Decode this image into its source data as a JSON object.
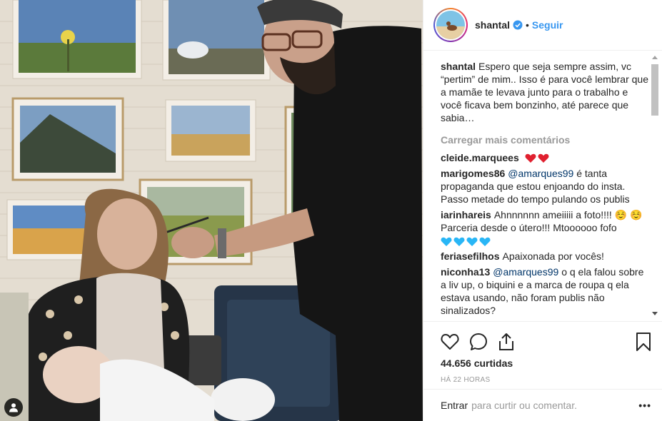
{
  "post": {
    "username": "shantal",
    "follow_label": "Seguir",
    "separator": "•"
  },
  "caption": {
    "username": "shantal",
    "text": "Espero que seja sempre assim, vc “pertim” de mim.. Isso é para você lembrar que a mamãe te levava junto para o trabalho e você ficava bem bonzinho, até parece que sabia…"
  },
  "load_more_label": "Carregar mais comentários",
  "comments": [
    {
      "username": "cleide.marquees",
      "text": ""
    },
    {
      "username": "marigomes86",
      "mention": "@amarques99",
      "text": "é tanta propaganda que estou enjoando do insta. Passo metade do tempo pulando os publis"
    },
    {
      "username": "iarinhareis",
      "text": "Ahnnnnnn ameiiiii a foto!!!! ☺️ ☺️ Parceria desde o útero!!! Mtoooooo fofo"
    },
    {
      "username": "feriasefilhos",
      "text": "Apaixonada por vocês!"
    },
    {
      "username": "niconha13",
      "mention": "@amarques99",
      "text": "o q ela falou sobre a liv up, o biquini e a marca de roupa q ela estava usando, não foram publis não sinalizados?"
    }
  ],
  "likes_text": "44.656 curtidas",
  "time_text": "HÁ 22 HORAS",
  "login_label": "Entrar",
  "comment_placeholder": "para curtir ou comentar.",
  "more_label": "•••",
  "colors": {
    "link_blue": "#3897f0",
    "mention_blue": "#003569",
    "heart_red": "#e0202f",
    "heart_blue": "#29b6f6",
    "border": "#efefef",
    "muted": "#999999"
  }
}
